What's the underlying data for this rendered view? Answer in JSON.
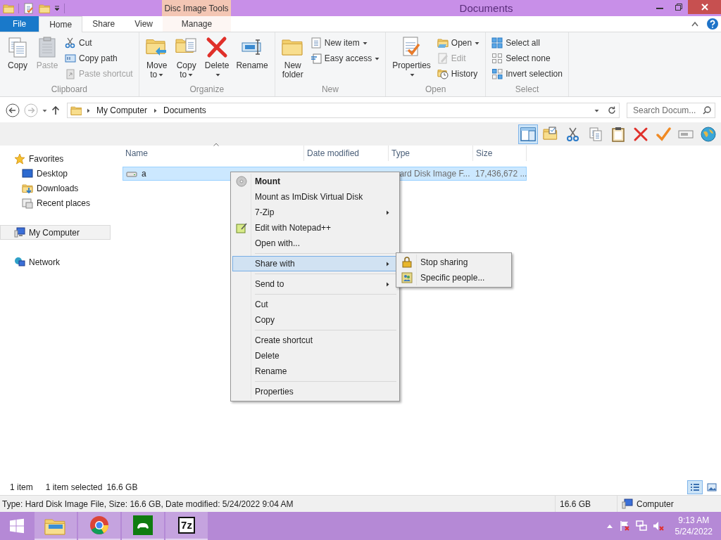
{
  "window": {
    "title": "Documents",
    "context_tab": "Disc Image Tools"
  },
  "ribbon": {
    "tabs": [
      {
        "label": "File",
        "kind": "file",
        "selected": false
      },
      {
        "label": "Home",
        "kind": "tab",
        "selected": true
      },
      {
        "label": "Share",
        "kind": "tab",
        "selected": false
      },
      {
        "label": "View",
        "kind": "tab",
        "selected": false
      },
      {
        "label": "Manage",
        "kind": "context",
        "selected": false
      }
    ],
    "groups": [
      {
        "label": "Clipboard",
        "items": [
          {
            "label": "Copy",
            "kind": "large",
            "disabled": false,
            "dropdown": false
          },
          {
            "label": "Paste",
            "kind": "large",
            "disabled": true,
            "dropdown": false
          },
          {
            "label": "Cut",
            "kind": "small",
            "disabled": false,
            "dropdown": false
          },
          {
            "label": "Copy path",
            "kind": "small",
            "disabled": false,
            "dropdown": false
          },
          {
            "label": "Paste shortcut",
            "kind": "small",
            "disabled": true,
            "dropdown": false
          }
        ]
      },
      {
        "label": "Organize",
        "items": [
          {
            "label": "Move to",
            "kind": "large",
            "disabled": false,
            "dropdown": true
          },
          {
            "label": "Copy to",
            "kind": "large",
            "disabled": false,
            "dropdown": true
          },
          {
            "label": "Delete",
            "kind": "large",
            "disabled": false,
            "dropdown": true
          },
          {
            "label": "Rename",
            "kind": "large",
            "disabled": false,
            "dropdown": false
          }
        ]
      },
      {
        "label": "New",
        "items": [
          {
            "label": "New folder",
            "kind": "large",
            "disabled": false,
            "dropdown": false
          },
          {
            "label": "New item",
            "kind": "small",
            "disabled": false,
            "dropdown": true
          },
          {
            "label": "Easy access",
            "kind": "small",
            "disabled": false,
            "dropdown": true
          }
        ]
      },
      {
        "label": "Open",
        "items": [
          {
            "label": "Properties",
            "kind": "large",
            "disabled": false,
            "dropdown": true
          },
          {
            "label": "Open",
            "kind": "small",
            "disabled": false,
            "dropdown": true
          },
          {
            "label": "Edit",
            "kind": "small",
            "disabled": true,
            "dropdown": false
          },
          {
            "label": "History",
            "kind": "small",
            "disabled": false,
            "dropdown": false
          }
        ]
      },
      {
        "label": "Select",
        "items": [
          {
            "label": "Select all",
            "kind": "small",
            "disabled": false,
            "dropdown": false
          },
          {
            "label": "Select none",
            "kind": "small",
            "disabled": false,
            "dropdown": false
          },
          {
            "label": "Invert selection",
            "kind": "small",
            "disabled": false,
            "dropdown": false
          }
        ]
      }
    ]
  },
  "address": {
    "breadcrumbs": [
      "My Computer",
      "Documents"
    ],
    "search": {
      "placeholder": "Search Docum..."
    }
  },
  "toolbar": {
    "buttons": [
      {
        "selected": true
      },
      {
        "selected": false
      },
      {
        "selected": false
      },
      {
        "selected": false
      },
      {
        "selected": false
      },
      {
        "selected": false
      },
      {
        "selected": false
      },
      {
        "selected": false
      },
      {
        "selected": false
      }
    ]
  },
  "navigation": [
    {
      "label": "Favorites",
      "selected": false,
      "children": [
        {
          "label": "Desktop",
          "selected": false
        },
        {
          "label": "Downloads",
          "selected": false
        },
        {
          "label": "Recent places",
          "selected": false
        }
      ]
    },
    {
      "label": "My Computer",
      "selected": true
    },
    {
      "label": "Network",
      "selected": false
    }
  ],
  "file_list": {
    "columns": [
      {
        "label": "Name",
        "sorted": true
      },
      {
        "label": "Date modified",
        "sorted": false
      },
      {
        "label": "Type",
        "sorted": false
      },
      {
        "label": "Size",
        "sorted": false
      }
    ],
    "rows": [
      {
        "name": "a",
        "type": "ard Disk Image F...",
        "size": "17,436,672 ...",
        "selected": true
      }
    ]
  },
  "context_menu": {
    "groups": [
      [
        {
          "label": "Mount",
          "default": true,
          "submenu": false,
          "selected": false
        },
        {
          "label": "Mount as ImDisk Virtual Disk",
          "default": false,
          "submenu": false,
          "selected": false
        },
        {
          "label": "7-Zip",
          "default": false,
          "submenu": true,
          "selected": false
        },
        {
          "label": "Edit with Notepad++",
          "default": false,
          "submenu": false,
          "selected": false
        },
        {
          "label": "Open with...",
          "default": false,
          "submenu": false,
          "selected": false
        }
      ],
      [
        {
          "label": "Share with",
          "default": false,
          "submenu": true,
          "selected": true
        }
      ],
      [
        {
          "label": "Send to",
          "default": false,
          "submenu": true,
          "selected": false
        }
      ],
      [
        {
          "label": "Cut",
          "default": false,
          "submenu": false,
          "selected": false
        },
        {
          "label": "Copy",
          "default": false,
          "submenu": false,
          "selected": false
        }
      ],
      [
        {
          "label": "Create shortcut",
          "default": false,
          "submenu": false,
          "selected": false
        },
        {
          "label": "Delete",
          "default": false,
          "submenu": false,
          "selected": false
        },
        {
          "label": "Rename",
          "default": false,
          "submenu": false,
          "selected": false
        }
      ],
      [
        {
          "label": "Properties",
          "default": false,
          "submenu": false,
          "selected": false
        }
      ]
    ],
    "submenu": [
      {
        "label": "Stop sharing",
        "selected": false
      },
      {
        "label": "Specific people...",
        "selected": false
      }
    ]
  },
  "status_bar": {
    "item_count": "1 item",
    "selection": "1 item selected",
    "selection_size": "16.6 GB",
    "views": [
      {
        "selected": true
      },
      {
        "selected": false
      }
    ]
  },
  "details_bar": {
    "text": "Type: Hard Disk Image File, Size: 16.6 GB, Date modified: 5/24/2022 9:04 AM",
    "size": "16.6 GB",
    "zone": "Computer"
  },
  "taskbar": {
    "apps": [
      {
        "running": true
      },
      {
        "running": true
      },
      {
        "running": true
      },
      {
        "running": true,
        "label": "7z"
      }
    ],
    "clock": {
      "time": "9:13 AM",
      "date": "5/24/2022"
    }
  }
}
